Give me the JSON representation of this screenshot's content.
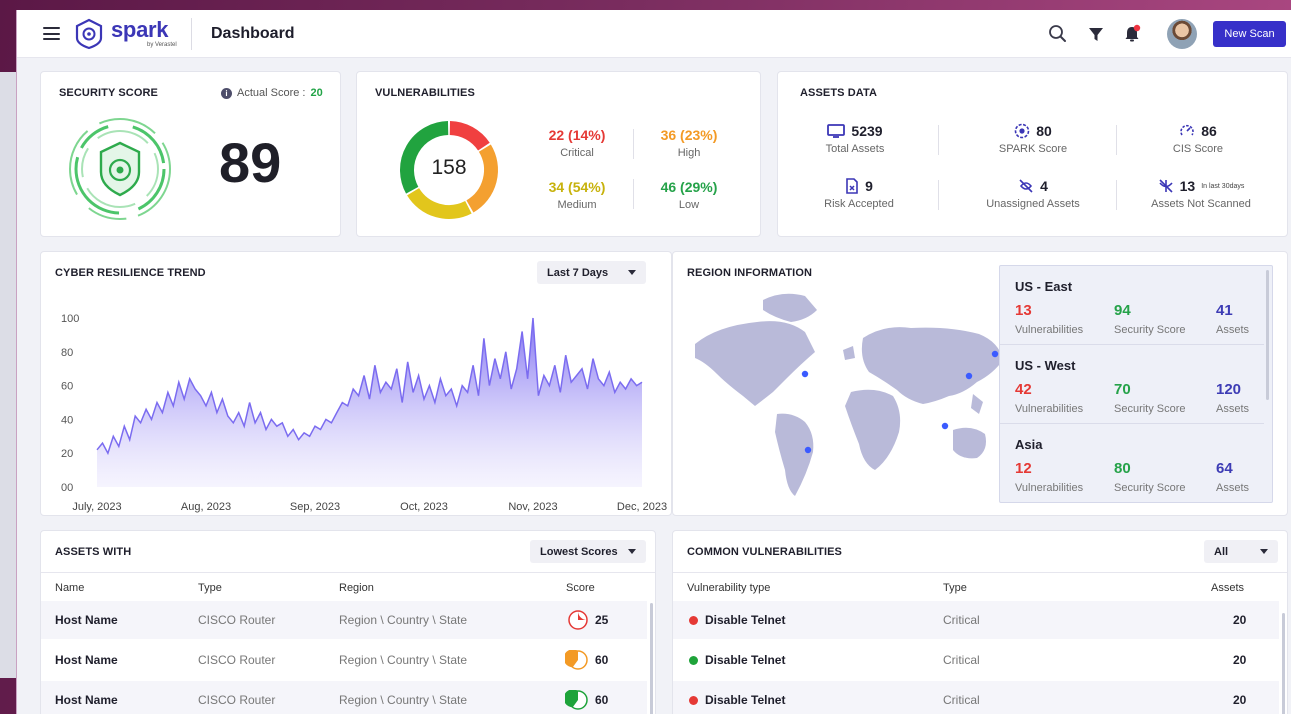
{
  "header": {
    "logo_text": "spark",
    "logo_sub": "by Verastel",
    "title": "Dashboard",
    "new_scan_label": "New Scan"
  },
  "security_score": {
    "title": "SECURITY SCORE",
    "actual_label": "Actual Score : ",
    "actual_value": "20",
    "score": "89"
  },
  "vulnerabilities": {
    "title": "VULNERABILITIES",
    "total": "158",
    "stats": [
      {
        "value": "22 (14%)",
        "label": "Critical",
        "color": "#e53935"
      },
      {
        "value": "36 (23%)",
        "label": "High",
        "color": "#f39a25"
      },
      {
        "value": "34 (54%)",
        "label": "Medium",
        "color": "#c7b20c"
      },
      {
        "value": "46 (29%)",
        "label": "Low",
        "color": "#25a249"
      }
    ],
    "donut": [
      {
        "name": "Critical",
        "value": 22,
        "color": "#f04040"
      },
      {
        "name": "High",
        "value": 36,
        "color": "#f4a030"
      },
      {
        "name": "Medium",
        "value": 34,
        "color": "#e2c61c"
      },
      {
        "name": "Low",
        "value": 46,
        "color": "#21a33f"
      }
    ]
  },
  "assets_data": {
    "title": "ASSETS DATA",
    "stats": [
      {
        "value": "5239",
        "label": "Total Assets",
        "icon": "monitor-icon"
      },
      {
        "value": "80",
        "label": "SPARK Score",
        "icon": "spark-score-icon"
      },
      {
        "value": "86",
        "label": "CIS Score",
        "icon": "cis-gauge-icon"
      },
      {
        "value": "9",
        "label": "Risk Accepted",
        "icon": "file-x-icon"
      },
      {
        "value": "4",
        "label": "Unassigned Assets",
        "icon": "unassigned-icon"
      },
      {
        "value": "13",
        "note": "In last 30days",
        "label": "Assets Not Scanned",
        "icon": "not-scanned-icon"
      }
    ]
  },
  "cyber_trend": {
    "title": "CYBER RESILIENCE TREND",
    "range_label": "Last 7 Days"
  },
  "chart_data": {
    "type": "area",
    "title": "CYBER RESILIENCE TREND",
    "x_ticks": [
      "July, 2023",
      "Aug, 2023",
      "Sep, 2023",
      "Oct, 2023",
      "Nov, 2023",
      "Dec, 2023"
    ],
    "y_ticks": [
      "100",
      "80",
      "60",
      "40",
      "20",
      "00"
    ],
    "ylim": [
      0,
      100
    ],
    "series": [
      {
        "color": "#7b6cf0",
        "values": [
          22,
          26,
          20,
          30,
          24,
          36,
          28,
          42,
          38,
          46,
          40,
          50,
          44,
          56,
          48,
          62,
          52,
          64,
          58,
          54,
          48,
          56,
          44,
          52,
          42,
          38,
          44,
          36,
          50,
          38,
          44,
          34,
          40,
          36,
          38,
          30,
          34,
          28,
          32,
          30,
          36,
          34,
          40,
          38,
          44,
          50,
          48,
          58,
          54,
          66,
          52,
          72,
          56,
          62,
          58,
          70,
          50,
          74,
          56,
          66,
          52,
          60,
          50,
          64,
          54,
          58,
          48,
          60,
          56,
          72,
          54,
          88,
          60,
          76,
          64,
          80,
          58,
          70,
          92,
          64,
          100,
          54,
          66,
          60,
          72,
          56,
          78,
          62,
          66,
          70,
          58,
          76,
          64,
          60,
          68,
          56,
          62,
          58,
          64,
          60,
          62
        ]
      }
    ]
  },
  "region_info": {
    "title": "REGION INFORMATION",
    "regions": [
      {
        "name": "US - East",
        "vuln": "13",
        "score": "94",
        "assets": "41"
      },
      {
        "name": "US - West",
        "vuln": "42",
        "score": "70",
        "assets": "120"
      },
      {
        "name": "Asia",
        "vuln": "12",
        "score": "80",
        "assets": "64"
      }
    ],
    "labels": {
      "vuln": "Vulnerabilities",
      "score": "Security Score",
      "assets": "Assets"
    },
    "colors": {
      "vuln": "#e53935",
      "score": "#25a249",
      "assets": "#3d3cb5"
    }
  },
  "assets_with": {
    "title": "ASSETS WITH",
    "filter": "Lowest Scores",
    "columns": [
      "Name",
      "Type",
      "Region",
      "Score"
    ],
    "rows": [
      {
        "name": "Host Name",
        "type": "CISCO Router",
        "region": "Region \\ Country \\ State",
        "score": "25",
        "score_fraction": 0.25,
        "score_color": "#e53935"
      },
      {
        "name": "Host Name",
        "type": "CISCO Router",
        "region": "Region \\ Country \\ State",
        "score": "60",
        "score_fraction": 0.6,
        "score_color": "#f39a25"
      },
      {
        "name": "Host Name",
        "type": "CISCO Router",
        "region": "Region \\ Country \\ State",
        "score": "60",
        "score_fraction": 0.6,
        "score_color": "#1ea33a"
      }
    ]
  },
  "common_vulns": {
    "title": "COMMON VULNERABILITIES",
    "filter": "All",
    "columns": [
      "Vulnerability type",
      "Type",
      "Assets"
    ],
    "rows": [
      {
        "name": "Disable Telnet",
        "type": "Critical",
        "assets": "20",
        "dot_color": "#e53935"
      },
      {
        "name": "Disable Telnet",
        "type": "Critical",
        "assets": "20",
        "dot_color": "#1ea33a"
      },
      {
        "name": "Disable Telnet",
        "type": "Critical",
        "assets": "20",
        "dot_color": "#e53935"
      }
    ]
  }
}
